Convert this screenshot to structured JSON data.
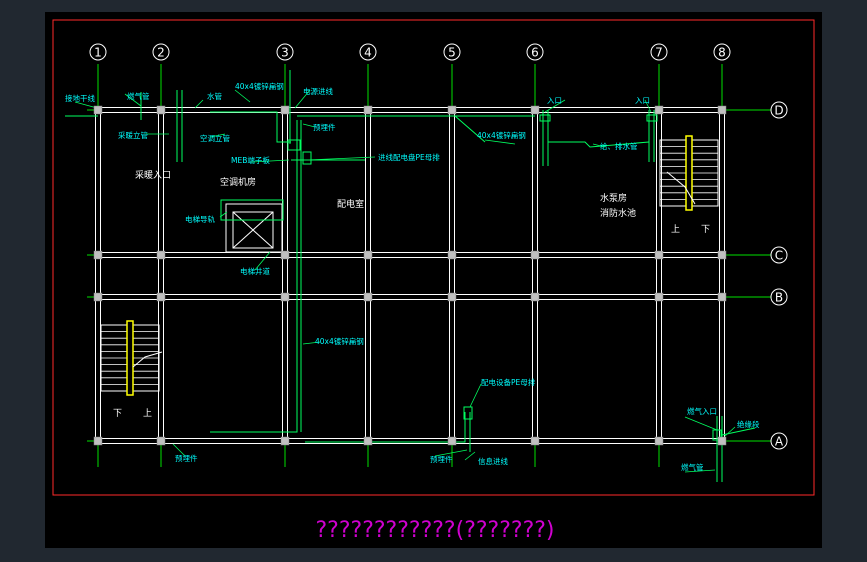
{
  "colors": {
    "background": "#212830",
    "sheet": "#000000",
    "border": "#ff2a2a",
    "grid_line": "#ffffff",
    "grid_fill": "#000000",
    "column": "#c0c0c0",
    "axis_line": "#00e000",
    "bubble_text": "#ffffff",
    "conduit": "#00ff60",
    "label": "#00ffff",
    "room_text": "#ffffff",
    "stair": "#ffff00",
    "title": "#d000d0"
  },
  "drawing": {
    "title": "????????????(???????)",
    "axes_vertical": [
      "1",
      "2",
      "3",
      "4",
      "5",
      "6",
      "7",
      "8"
    ],
    "axes_horizontal": [
      "D",
      "C",
      "B",
      "A"
    ],
    "rooms": [
      {
        "id": "heating-entry",
        "text": "采暖入口"
      },
      {
        "id": "ac-room",
        "text": "空调机房"
      },
      {
        "id": "distribution-room",
        "text": "配电室"
      },
      {
        "id": "pump-room",
        "text": "水泵房"
      },
      {
        "id": "fire-pool",
        "text": "消防水池"
      }
    ],
    "annotations": [
      {
        "id": "grounding-main",
        "text": "接地干线"
      },
      {
        "id": "gas-pipe-top",
        "text": "燃气管"
      },
      {
        "id": "heating-riser",
        "text": "采暖立管"
      },
      {
        "id": "water-pipe",
        "text": "水管"
      },
      {
        "id": "flat-steel-top",
        "text": "40x4镀锌扁钢"
      },
      {
        "id": "power-inlet",
        "text": "电源进线"
      },
      {
        "id": "ac-riser",
        "text": "空调立管"
      },
      {
        "id": "embed-top",
        "text": "预埋件"
      },
      {
        "id": "meb-box",
        "text": "MEB端子板"
      },
      {
        "id": "dist-pe",
        "text": "进线配电盘PE母排"
      },
      {
        "id": "flat-steel-right",
        "text": "40x4镀锌扁钢"
      },
      {
        "id": "entry-1",
        "text": "入口"
      },
      {
        "id": "entry-2",
        "text": "入口"
      },
      {
        "id": "water-supply",
        "text": "给、排水管"
      },
      {
        "id": "elevator-guide",
        "text": "电梯导轨"
      },
      {
        "id": "elevator-shaft",
        "text": "电梯井道"
      },
      {
        "id": "flat-steel-mid",
        "text": "40x4镀锌扁钢"
      },
      {
        "id": "equip-pe",
        "text": "配电设备PE母排"
      },
      {
        "id": "gas-entry",
        "text": "燃气入口"
      },
      {
        "id": "insulation",
        "text": "绝缘段"
      },
      {
        "id": "embed-bottom-left",
        "text": "预埋件"
      },
      {
        "id": "embed-bottom-mid",
        "text": "预埋件"
      },
      {
        "id": "signal-inlet",
        "text": "信息进线"
      },
      {
        "id": "gas-pipe-bottom",
        "text": "燃气管"
      },
      {
        "id": "stair-right-up",
        "text": "上"
      },
      {
        "id": "stair-right-down",
        "text": "下"
      },
      {
        "id": "stair-left-down",
        "text": "下"
      },
      {
        "id": "stair-left-up",
        "text": "上"
      }
    ]
  }
}
